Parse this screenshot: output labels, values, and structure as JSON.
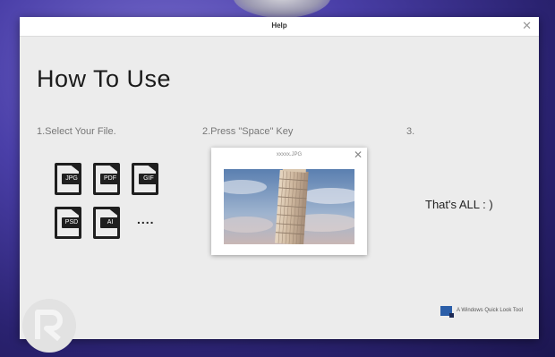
{
  "window": {
    "title": "Help",
    "close_glyph": "✕"
  },
  "main": {
    "heading": "How To Use",
    "steps": [
      {
        "label": "1.Select Your File."
      },
      {
        "label": "2.Press \"Space\" Key"
      },
      {
        "label": "3."
      }
    ],
    "file_types": [
      "JPG",
      "PDF",
      "GIF",
      "PSD",
      "AI"
    ],
    "more_glyph": "....",
    "preview": {
      "filename": "xxxxx.JPG",
      "close_glyph": "✕",
      "image_subject": "leaning-tower-photo"
    },
    "closing_text": "That's ALL   : )"
  },
  "footer": {
    "brand_text": "A Windows Quick Look Tool",
    "brand_icon": "app-logo-icon"
  },
  "colors": {
    "background": "#3a3090",
    "window": "#ececec",
    "file_icon": "#1f1f1f",
    "brand_blue": "#2b5ea8"
  }
}
